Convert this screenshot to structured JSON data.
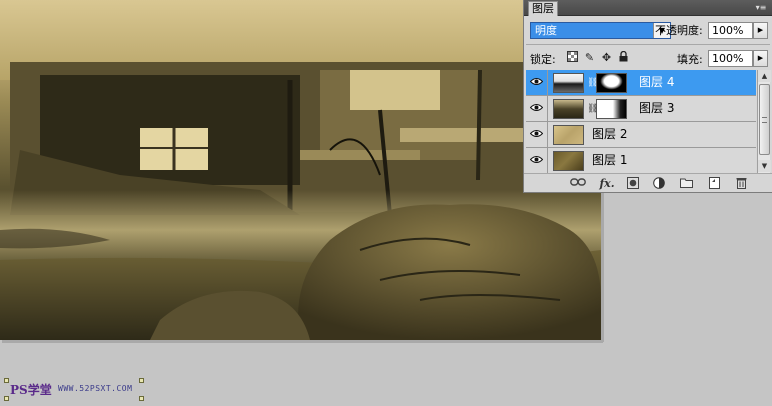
{
  "panel": {
    "tab_label": "图层",
    "blend_mode": "明度",
    "opacity_label": "不透明度:",
    "opacity_value": "100%",
    "lock_label": "锁定:",
    "fill_label": "填充:",
    "fill_value": "100%",
    "layers": [
      {
        "name": "图层 4",
        "selected": true,
        "has_mask": true
      },
      {
        "name": "图层 3",
        "selected": false,
        "has_mask": true
      },
      {
        "name": "图层 2",
        "selected": false,
        "has_mask": false
      },
      {
        "name": "图层 1",
        "selected": false,
        "has_mask": false
      }
    ],
    "footer_icons": [
      "link-icon",
      "fx-icon",
      "add-mask-icon",
      "adjustment-layer-icon",
      "group-folder-icon",
      "new-layer-icon",
      "trash-icon"
    ],
    "lock_icons": [
      "lock-transparent-icon",
      "lock-image-icon",
      "lock-position-icon",
      "lock-all-icon"
    ],
    "selection_color": "#3d9af0"
  },
  "watermark": {
    "logo_text": "PS学堂",
    "url_text": "WWW.52PSXT.COM"
  },
  "footer": {
    "fx_label": "fx."
  }
}
